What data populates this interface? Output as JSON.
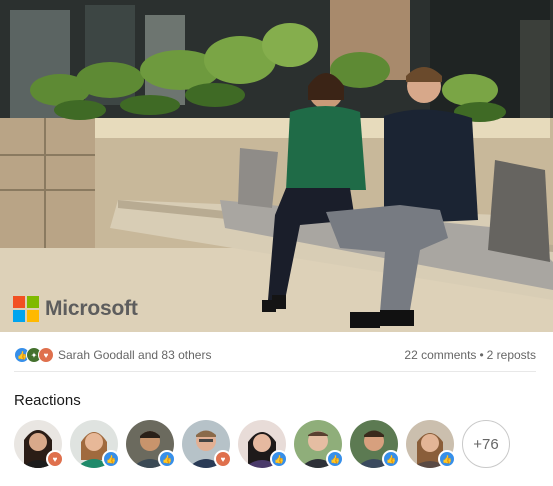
{
  "photo": {
    "brand": {
      "name": "Microsoft"
    }
  },
  "social": {
    "reaction_icons": [
      "like-icon",
      "celebrate-icon",
      "love-icon"
    ],
    "reactors_text": "Sarah Goodall and 83 others",
    "comments_text": "22 comments",
    "separator": "•",
    "reposts_text": "2 reposts"
  },
  "reactions": {
    "title": "Reactions",
    "people": [
      {
        "reaction": "love"
      },
      {
        "reaction": "like"
      },
      {
        "reaction": "like"
      },
      {
        "reaction": "love"
      },
      {
        "reaction": "like"
      },
      {
        "reaction": "like"
      },
      {
        "reaction": "like"
      },
      {
        "reaction": "like"
      }
    ],
    "more_label": "+76"
  },
  "colors": {
    "like": "#378fe9",
    "love": "#df704d",
    "celebrate": "#44712e",
    "text_secondary": "#666666"
  }
}
